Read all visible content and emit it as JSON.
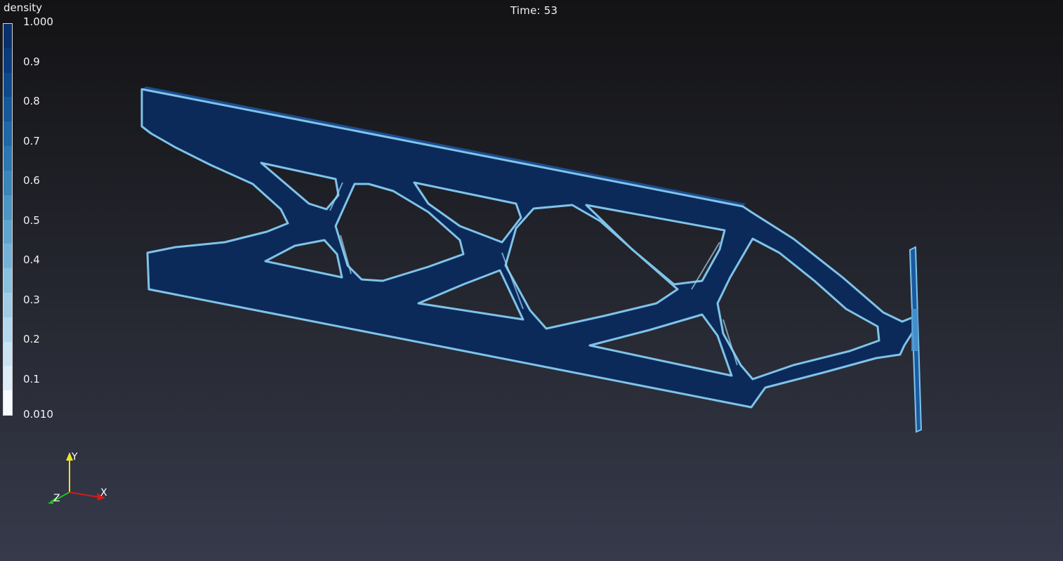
{
  "view": {
    "time_label": "Time: 53"
  },
  "scalar_bar": {
    "title": "density",
    "range": [
      0.01,
      1.0
    ],
    "tick_labels": [
      "1.000",
      "0.9",
      "0.8",
      "0.7",
      "0.6",
      "0.5",
      "0.4",
      "0.3",
      "0.2",
      "0.1",
      "0.010"
    ],
    "band_colors": [
      "#08306b",
      "#0a3b7d",
      "#0d4a8c",
      "#15599a",
      "#1f68a6",
      "#2c77b2",
      "#3a86bb",
      "#4b96c4",
      "#5fa5ce",
      "#74b3d7",
      "#8ac1de",
      "#a0cde5",
      "#b6d8ec",
      "#cbe3f2",
      "#dfedf7",
      "#f7fbff"
    ]
  },
  "orientation_axes": {
    "x_label": "X",
    "y_label": "Y",
    "z_label": "Z",
    "x_color": "#d01c1c",
    "y_color": "#e8e82a",
    "z_color": "#1fbf1f"
  },
  "model": {
    "solid_color": "#0b2a5a",
    "face_color": "#0d3373",
    "edge_highlight": "#7fc3ea"
  }
}
